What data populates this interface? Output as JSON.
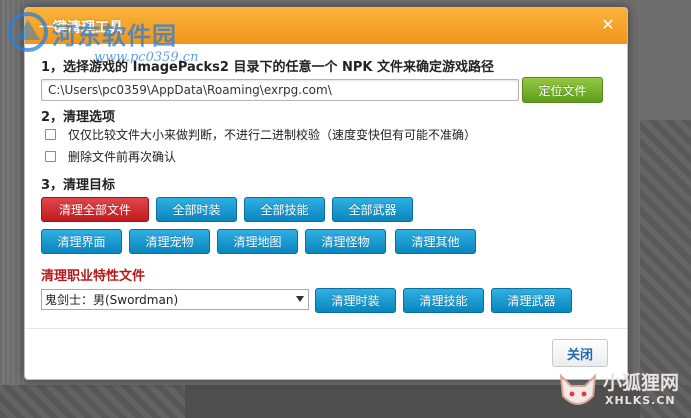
{
  "dialog": {
    "title": "一键清理工具",
    "close_icon": "close-icon"
  },
  "watermark": {
    "text": "河东软件园",
    "url": "www.pc0359.cn"
  },
  "section1": {
    "label": "1，选择游戏的 ImagePacks2 目录下的任意一个 NPK 文件来确定游戏路径",
    "path_value": "C:\\Users\\pc0359\\AppData\\Roaming\\exrpg.com\\",
    "locate_button": "定位文件"
  },
  "section2": {
    "label": "2，清理选项",
    "options": [
      {
        "label": "仅仅比较文件大小来做判断，不进行二进制校验（速度变快但有可能不准确）",
        "checked": false
      },
      {
        "label": "删除文件前再次确认",
        "checked": false
      }
    ]
  },
  "section3": {
    "label": "3，清理目标",
    "row1": [
      "清理全部文件",
      "全部时装",
      "全部技能",
      "全部武器"
    ],
    "row2": [
      "清理界面",
      "清理宠物",
      "清理地图",
      "清理怪物",
      "清理其他"
    ]
  },
  "job": {
    "heading": "清理职业特性文件",
    "selected": "鬼剑士：男(Swordman)",
    "buttons": [
      "清理时装",
      "清理技能",
      "清理武器"
    ]
  },
  "footer": {
    "close_button": "关闭"
  },
  "fox_watermark": {
    "text": "小狐狸网",
    "url": "XHLKS.CN"
  },
  "colors": {
    "header": "#f1951d",
    "blue_button": "#0a85bf",
    "green_button": "#5c9d1b",
    "red_button": "#c01b20",
    "job_heading": "#b51a1a"
  }
}
